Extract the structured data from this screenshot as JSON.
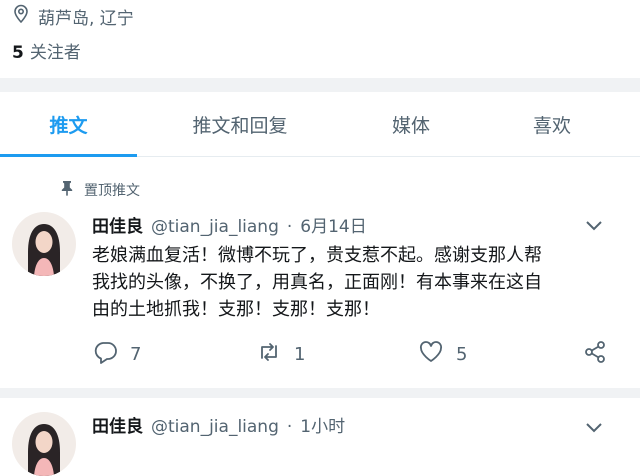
{
  "profile": {
    "location": "葫芦岛, 辽宁",
    "followers_count": "5",
    "followers_label": "关注者"
  },
  "tabs": [
    {
      "label": "推文",
      "active": true
    },
    {
      "label": "推文和回复",
      "active": false
    },
    {
      "label": "媒体",
      "active": false
    },
    {
      "label": "喜欢",
      "active": false
    }
  ],
  "pinned_label": "置顶推文",
  "tweets": [
    {
      "name": "田佳良",
      "handle": "@tian_jia_liang",
      "separator": "·",
      "date": "6月14日",
      "lines": [
        "老娘满血复活！微博不玩了，贵支惹不起。感谢支那人帮",
        "我找的头像，不换了，用真名，正面刚！有本事来在这自",
        "由的土地抓我！支那！支那！支那！"
      ],
      "replies": "7",
      "retweets": "1",
      "likes": "5"
    },
    {
      "name": "田佳良",
      "handle": "@tian_jia_liang",
      "separator": "·",
      "date": "1小时"
    }
  ],
  "icons": {
    "location": "location-pin-icon",
    "pin": "pin-icon",
    "chevron": "chevron-down-icon",
    "reply": "reply-icon",
    "retweet": "retweet-icon",
    "like": "heart-icon",
    "share": "share-icon"
  },
  "colors": {
    "accent": "#1d9bf0",
    "secondary_text": "#536471",
    "primary_text": "#14171a"
  }
}
